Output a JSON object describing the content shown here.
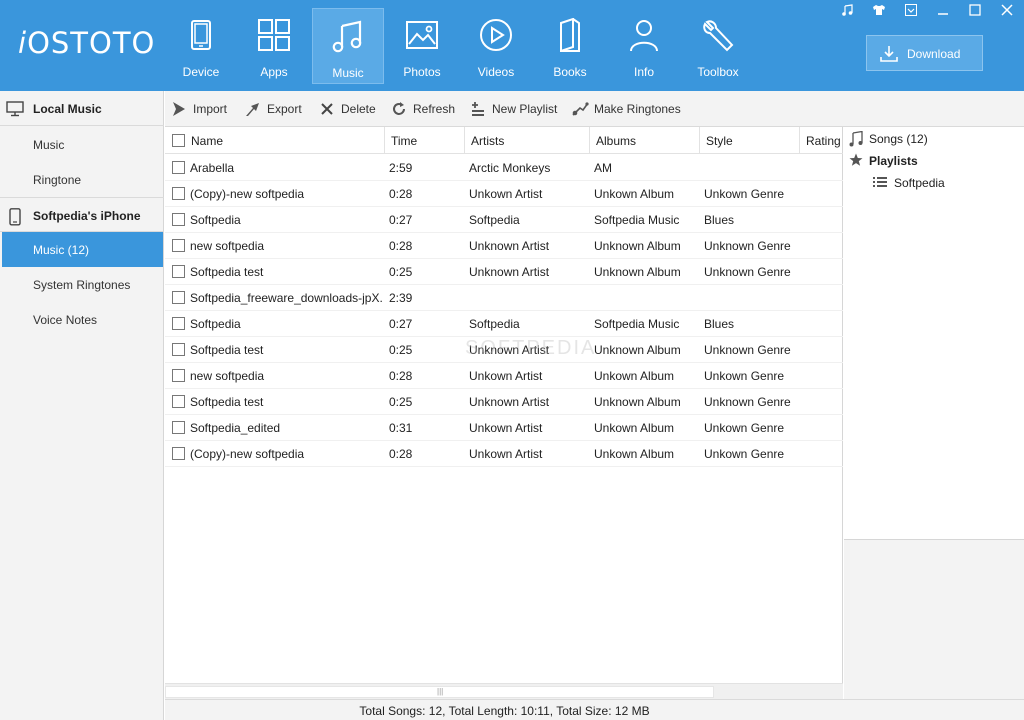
{
  "app": {
    "logo": "iOSTOTO",
    "logo_i": "i",
    "logo_rest": "OSTOTO"
  },
  "nav": [
    {
      "label": "Device",
      "icon": "device-icon"
    },
    {
      "label": "Apps",
      "icon": "apps-icon"
    },
    {
      "label": "Music",
      "icon": "music-icon",
      "active": true
    },
    {
      "label": "Photos",
      "icon": "photos-icon"
    },
    {
      "label": "Videos",
      "icon": "videos-icon"
    },
    {
      "label": "Books",
      "icon": "books-icon"
    },
    {
      "label": "Info",
      "icon": "info-icon"
    },
    {
      "label": "Toolbox",
      "icon": "toolbox-icon"
    }
  ],
  "download_label": "Download",
  "sidebar": {
    "local_group": "Local Music",
    "local_items": [
      "Music",
      "Ringtone"
    ],
    "device_group": "Softpedia's iPhone",
    "device_items": [
      "Music (12)",
      "System Ringtones",
      "Voice Notes"
    ]
  },
  "toolbar": {
    "import": "Import",
    "export": "Export",
    "delete": "Delete",
    "refresh": "Refresh",
    "new_playlist": "New Playlist",
    "make_ringtones": "Make Ringtones"
  },
  "table": {
    "columns": [
      "Name",
      "Time",
      "Artists",
      "Albums",
      "Style",
      "Rating"
    ],
    "rows": [
      [
        "Arabella",
        "2:59",
        "Arctic Monkeys",
        "AM",
        ""
      ],
      [
        "(Copy)-new softpedia",
        "0:28",
        "Unkown Artist",
        "Unkown Album",
        "Unkown Genre"
      ],
      [
        "Softpedia",
        "0:27",
        "Softpedia",
        "Softpedia Music",
        "Blues"
      ],
      [
        "new softpedia",
        "0:28",
        "Unknown Artist",
        "Unknown Album",
        "Unknown Genre"
      ],
      [
        "Softpedia test",
        "0:25",
        "Unknown Artist",
        "Unknown Album",
        "Unknown Genre"
      ],
      [
        "Softpedia_freeware_downloads-jpX...",
        "2:39",
        "",
        "",
        ""
      ],
      [
        "Softpedia",
        "0:27",
        "Softpedia",
        "Softpedia Music",
        "Blues"
      ],
      [
        "Softpedia test",
        "0:25",
        "Unknown Artist",
        "Unknown Album",
        "Unknown Genre"
      ],
      [
        "new softpedia",
        "0:28",
        "Unkown Artist",
        "Unkown Album",
        "Unkown Genre"
      ],
      [
        "Softpedia test",
        "0:25",
        "Unknown Artist",
        "Unknown Album",
        "Unknown Genre"
      ],
      [
        "Softpedia_edited",
        "0:31",
        "Unkown Artist",
        "Unkown Album",
        "Unkown Genre"
      ],
      [
        "(Copy)-new softpedia",
        "0:28",
        "Unkown Artist",
        "Unkown Album",
        "Unkown Genre"
      ]
    ]
  },
  "watermark": "SOFTPEDIA",
  "right_panel": {
    "songs": "Songs (12)",
    "playlists": "Playlists",
    "playlist_items": [
      "Softpedia"
    ]
  },
  "status": "Total Songs: 12, Total Length: 10:11, Total Size: 12 MB",
  "colors": {
    "accent": "#3a96dc",
    "active_nav": "#5aaae6"
  }
}
